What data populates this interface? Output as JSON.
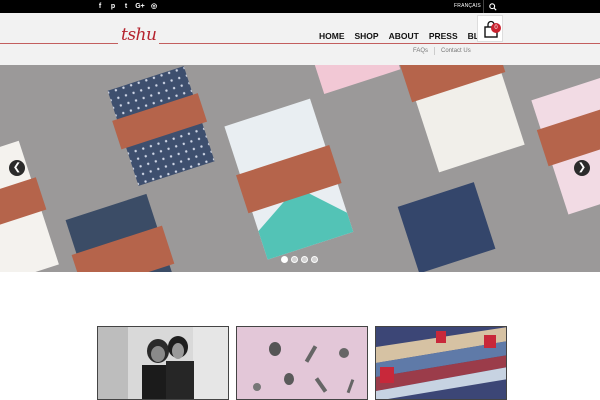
{
  "topbar": {
    "social_icons": [
      {
        "name": "facebook",
        "glyph": "f"
      },
      {
        "name": "pinterest",
        "glyph": "p"
      },
      {
        "name": "twitter",
        "glyph": "t"
      },
      {
        "name": "google-plus",
        "glyph": "G+"
      },
      {
        "name": "instagram",
        "glyph": "◎"
      }
    ],
    "language_label": "FRANÇAIS"
  },
  "header": {
    "logo_text": "tshu",
    "nav": [
      "HOME",
      "SHOP",
      "ABOUT",
      "PRESS",
      "BLOG"
    ],
    "subnav": [
      "FAQs",
      "Contact Us"
    ],
    "cart_count": "0"
  },
  "slider": {
    "prev_glyph": "❮",
    "next_glyph": "❯",
    "slide_count": 4,
    "active_slide": 1
  },
  "colors": {
    "brand_red": "#b5232e",
    "band_tan": "#b8644a",
    "topbar": "#000000"
  }
}
